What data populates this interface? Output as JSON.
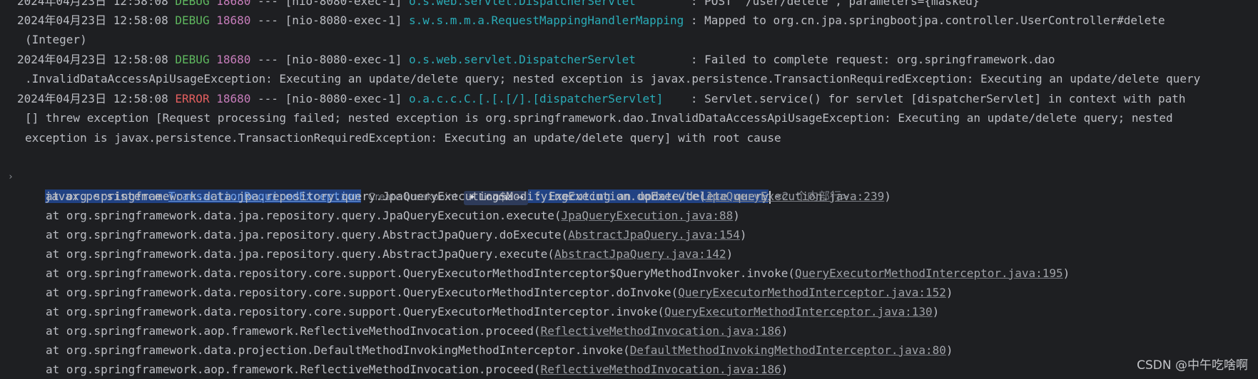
{
  "log": {
    "lines": [
      {
        "date": "2024年04月23日 12:58:08 ",
        "level": "DEBUG",
        "pid": "18680",
        "thread": "--- [nio-8080-exec-1] ",
        "logger": "o.s.web.servlet.DispatcherServlet        ",
        "message": ": POST \"/user/delete\", parameters={masked}"
      },
      {
        "date": "2024年04月23日 12:58:08 ",
        "level": "DEBUG",
        "pid": "18680",
        "thread": "--- [nio-8080-exec-1] ",
        "logger": "s.w.s.m.m.a.RequestMappingHandlerMapping ",
        "message": ": Mapped to org.cn.jpa.springbootjpa.controller.UserController#delete",
        "cont": [
          "(Integer)"
        ]
      },
      {
        "date": "2024年04月23日 12:58:08 ",
        "level": "DEBUG",
        "pid": "18680",
        "thread": "--- [nio-8080-exec-1] ",
        "logger": "o.s.web.servlet.DispatcherServlet        ",
        "message": ": Failed to complete request: org.springframework.dao",
        "cont": [
          ".InvalidDataAccessApiUsageException: Executing an update/delete query; nested exception is javax.persistence.TransactionRequiredException: Executing an update/delete query"
        ]
      },
      {
        "date": "2024年04月23日 12:58:08 ",
        "level": "ERROR",
        "pid": "18680",
        "thread": "--- [nio-8080-exec-1] ",
        "logger": "o.a.c.c.C.[.[.[/].[dispatcherServlet]    ",
        "message": ": Servlet.service() for servlet [dispatcherServlet] in context with path",
        "cont": [
          "[] threw exception [Request processing failed; nested exception is org.springframework.dao.InvalidDataAccessApiUsageException: Executing an update/delete query; nested",
          "exception is javax.persistence.TransactionRequiredException: Executing an update/delete query] with root cause"
        ]
      }
    ],
    "exception": {
      "package": "javax.persistence.",
      "class": "TransactionRequiredException",
      "create_breakpoint": "Create breakpoint",
      "lingma": "Lingma →",
      "message": " : Executing an update/delete query",
      "folded": "<2 个内部行>"
    },
    "stack": [
      {
        "prefix": "at org.springframework.data.jpa.repository.query.JpaQueryExecution$ModifyingExecution.doExecute(",
        "link": "JpaQueryExecution.java:239"
      },
      {
        "prefix": "at org.springframework.data.jpa.repository.query.JpaQueryExecution.execute(",
        "link": "JpaQueryExecution.java:88"
      },
      {
        "prefix": "at org.springframework.data.jpa.repository.query.AbstractJpaQuery.doExecute(",
        "link": "AbstractJpaQuery.java:154"
      },
      {
        "prefix": "at org.springframework.data.jpa.repository.query.AbstractJpaQuery.execute(",
        "link": "AbstractJpaQuery.java:142"
      },
      {
        "prefix": "at org.springframework.data.repository.core.support.QueryExecutorMethodInterceptor$QueryMethodInvoker.invoke(",
        "link": "QueryExecutorMethodInterceptor.java:195"
      },
      {
        "prefix": "at org.springframework.data.repository.core.support.QueryExecutorMethodInterceptor.doInvoke(",
        "link": "QueryExecutorMethodInterceptor.java:152"
      },
      {
        "prefix": "at org.springframework.data.repository.core.support.QueryExecutorMethodInterceptor.invoke(",
        "link": "QueryExecutorMethodInterceptor.java:130"
      },
      {
        "prefix": "at org.springframework.aop.framework.ReflectiveMethodInvocation.proceed(",
        "link": "ReflectiveMethodInvocation.java:186"
      },
      {
        "prefix": "at org.springframework.data.projection.DefaultMethodInvokingMethodInterceptor.invoke(",
        "link": "DefaultMethodInvokingMethodInterceptor.java:80"
      },
      {
        "prefix": "at org.springframework.aop.framework.ReflectiveMethodInvocation.proceed(",
        "link": "ReflectiveMethodInvocation.java:186"
      }
    ],
    "close_paren": ")"
  },
  "watermark": "CSDN @中午吃啥啊",
  "colors": {
    "background": "#1e1f22",
    "debug": "#5fb85f",
    "error": "#e35f5f",
    "pid": "#c77dbb",
    "logger": "#2aacb8",
    "selection": "#214283"
  }
}
